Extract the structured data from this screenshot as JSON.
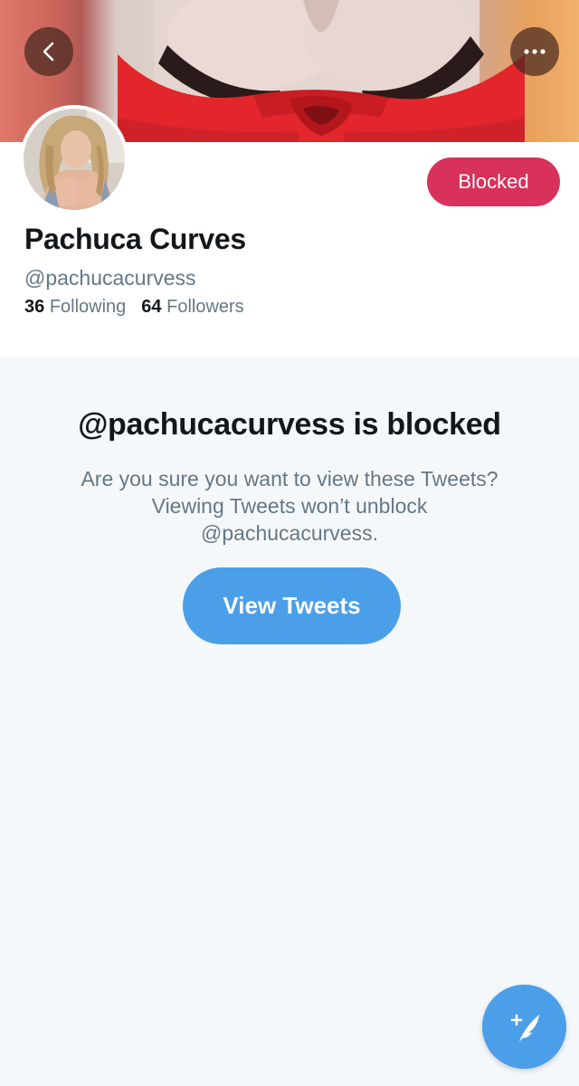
{
  "profile": {
    "display_name": "Pachuca Curves",
    "handle": "@pachucacurvess",
    "following_count": "36",
    "following_label": "Following",
    "followers_count": "64",
    "followers_label": "Followers",
    "blocked_button_label": "Blocked"
  },
  "blocked_notice": {
    "title": "@pachucacurvess is blocked",
    "message_line1": "Are you sure you want to view these Tweets?",
    "message_line2": "Viewing Tweets won’t unblock",
    "message_line3": "@pachucacurvess.",
    "view_button_label": "View Tweets"
  },
  "colors": {
    "blocked_red": "#d8315b",
    "twitter_blue": "#4a9fe8",
    "background": "#f5f8fa",
    "text_primary": "#14171a",
    "text_secondary": "#657786"
  },
  "icons": {
    "back": "chevron-left-icon",
    "more": "more-horizontal-icon",
    "compose": "compose-tweet-icon"
  }
}
